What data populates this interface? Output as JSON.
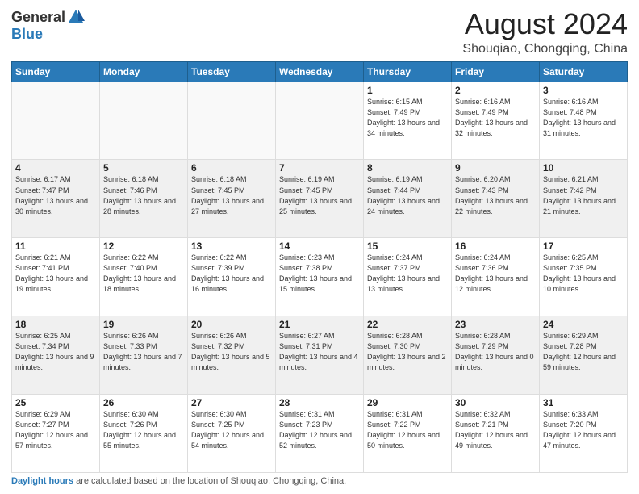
{
  "header": {
    "logo_general": "General",
    "logo_blue": "Blue",
    "month_title": "August 2024",
    "location": "Shouqiao, Chongqing, China"
  },
  "weekdays": [
    "Sunday",
    "Monday",
    "Tuesday",
    "Wednesday",
    "Thursday",
    "Friday",
    "Saturday"
  ],
  "weeks": [
    [
      {
        "day": "",
        "info": "",
        "empty": true
      },
      {
        "day": "",
        "info": "",
        "empty": true
      },
      {
        "day": "",
        "info": "",
        "empty": true
      },
      {
        "day": "",
        "info": "",
        "empty": true
      },
      {
        "day": "1",
        "info": "Sunrise: 6:15 AM\nSunset: 7:49 PM\nDaylight: 13 hours\nand 34 minutes."
      },
      {
        "day": "2",
        "info": "Sunrise: 6:16 AM\nSunset: 7:49 PM\nDaylight: 13 hours\nand 32 minutes."
      },
      {
        "day": "3",
        "info": "Sunrise: 6:16 AM\nSunset: 7:48 PM\nDaylight: 13 hours\nand 31 minutes."
      }
    ],
    [
      {
        "day": "4",
        "info": "Sunrise: 6:17 AM\nSunset: 7:47 PM\nDaylight: 13 hours\nand 30 minutes."
      },
      {
        "day": "5",
        "info": "Sunrise: 6:18 AM\nSunset: 7:46 PM\nDaylight: 13 hours\nand 28 minutes."
      },
      {
        "day": "6",
        "info": "Sunrise: 6:18 AM\nSunset: 7:45 PM\nDaylight: 13 hours\nand 27 minutes."
      },
      {
        "day": "7",
        "info": "Sunrise: 6:19 AM\nSunset: 7:45 PM\nDaylight: 13 hours\nand 25 minutes."
      },
      {
        "day": "8",
        "info": "Sunrise: 6:19 AM\nSunset: 7:44 PM\nDaylight: 13 hours\nand 24 minutes."
      },
      {
        "day": "9",
        "info": "Sunrise: 6:20 AM\nSunset: 7:43 PM\nDaylight: 13 hours\nand 22 minutes."
      },
      {
        "day": "10",
        "info": "Sunrise: 6:21 AM\nSunset: 7:42 PM\nDaylight: 13 hours\nand 21 minutes."
      }
    ],
    [
      {
        "day": "11",
        "info": "Sunrise: 6:21 AM\nSunset: 7:41 PM\nDaylight: 13 hours\nand 19 minutes."
      },
      {
        "day": "12",
        "info": "Sunrise: 6:22 AM\nSunset: 7:40 PM\nDaylight: 13 hours\nand 18 minutes."
      },
      {
        "day": "13",
        "info": "Sunrise: 6:22 AM\nSunset: 7:39 PM\nDaylight: 13 hours\nand 16 minutes."
      },
      {
        "day": "14",
        "info": "Sunrise: 6:23 AM\nSunset: 7:38 PM\nDaylight: 13 hours\nand 15 minutes."
      },
      {
        "day": "15",
        "info": "Sunrise: 6:24 AM\nSunset: 7:37 PM\nDaylight: 13 hours\nand 13 minutes."
      },
      {
        "day": "16",
        "info": "Sunrise: 6:24 AM\nSunset: 7:36 PM\nDaylight: 13 hours\nand 12 minutes."
      },
      {
        "day": "17",
        "info": "Sunrise: 6:25 AM\nSunset: 7:35 PM\nDaylight: 13 hours\nand 10 minutes."
      }
    ],
    [
      {
        "day": "18",
        "info": "Sunrise: 6:25 AM\nSunset: 7:34 PM\nDaylight: 13 hours\nand 9 minutes."
      },
      {
        "day": "19",
        "info": "Sunrise: 6:26 AM\nSunset: 7:33 PM\nDaylight: 13 hours\nand 7 minutes."
      },
      {
        "day": "20",
        "info": "Sunrise: 6:26 AM\nSunset: 7:32 PM\nDaylight: 13 hours\nand 5 minutes."
      },
      {
        "day": "21",
        "info": "Sunrise: 6:27 AM\nSunset: 7:31 PM\nDaylight: 13 hours\nand 4 minutes."
      },
      {
        "day": "22",
        "info": "Sunrise: 6:28 AM\nSunset: 7:30 PM\nDaylight: 13 hours\nand 2 minutes."
      },
      {
        "day": "23",
        "info": "Sunrise: 6:28 AM\nSunset: 7:29 PM\nDaylight: 13 hours\nand 0 minutes."
      },
      {
        "day": "24",
        "info": "Sunrise: 6:29 AM\nSunset: 7:28 PM\nDaylight: 12 hours\nand 59 minutes."
      }
    ],
    [
      {
        "day": "25",
        "info": "Sunrise: 6:29 AM\nSunset: 7:27 PM\nDaylight: 12 hours\nand 57 minutes."
      },
      {
        "day": "26",
        "info": "Sunrise: 6:30 AM\nSunset: 7:26 PM\nDaylight: 12 hours\nand 55 minutes."
      },
      {
        "day": "27",
        "info": "Sunrise: 6:30 AM\nSunset: 7:25 PM\nDaylight: 12 hours\nand 54 minutes."
      },
      {
        "day": "28",
        "info": "Sunrise: 6:31 AM\nSunset: 7:23 PM\nDaylight: 12 hours\nand 52 minutes."
      },
      {
        "day": "29",
        "info": "Sunrise: 6:31 AM\nSunset: 7:22 PM\nDaylight: 12 hours\nand 50 minutes."
      },
      {
        "day": "30",
        "info": "Sunrise: 6:32 AM\nSunset: 7:21 PM\nDaylight: 12 hours\nand 49 minutes."
      },
      {
        "day": "31",
        "info": "Sunrise: 6:33 AM\nSunset: 7:20 PM\nDaylight: 12 hours\nand 47 minutes."
      }
    ]
  ],
  "footer": {
    "label": "Daylight hours",
    "text": " are calculated based on the location of Shouqiao, Chongqing, China."
  }
}
